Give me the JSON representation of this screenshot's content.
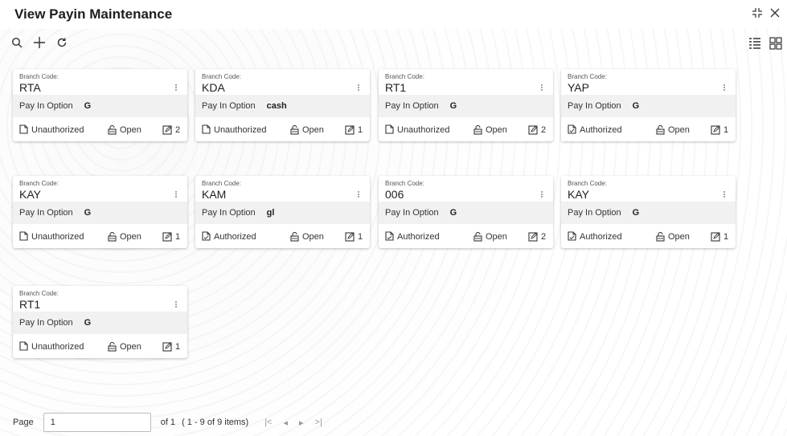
{
  "window": {
    "title": "View Payin Maintenance"
  },
  "toolbar": {
    "search": "search-icon",
    "add": "plus-icon",
    "refresh": "refresh-icon"
  },
  "cards": [
    {
      "code_label": "Branch Code:",
      "code": "RTA",
      "option_label": "Pay In Option",
      "option": "G",
      "auth": "Unauthorized",
      "status": "Open",
      "count": "2"
    },
    {
      "code_label": "Branch Code:",
      "code": "KDA",
      "option_label": "Pay In Option",
      "option": "cash",
      "auth": "Unauthorized",
      "status": "Open",
      "count": "1"
    },
    {
      "code_label": "Branch Code:",
      "code": "RT1",
      "option_label": "Pay In Option",
      "option": "G",
      "auth": "Unauthorized",
      "status": "Open",
      "count": "2"
    },
    {
      "code_label": "Branch Code:",
      "code": "YAP",
      "option_label": "Pay In Option",
      "option": "G",
      "auth": "Authorized",
      "status": "Open",
      "count": "1"
    },
    {
      "code_label": "Branch Code:",
      "code": "KAY",
      "option_label": "Pay In Option",
      "option": "G",
      "auth": "Unauthorized",
      "status": "Open",
      "count": "1"
    },
    {
      "code_label": "Branch Code:",
      "code": "KAM",
      "option_label": "Pay In Option",
      "option": "gl",
      "auth": "Authorized",
      "status": "Open",
      "count": "1"
    },
    {
      "code_label": "Branch Code:",
      "code": "006",
      "option_label": "Pay In Option",
      "option": "G",
      "auth": "Authorized",
      "status": "Open",
      "count": "2"
    },
    {
      "code_label": "Branch Code:",
      "code": "KAY",
      "option_label": "Pay In Option",
      "option": "G",
      "auth": "Authorized",
      "status": "Open",
      "count": "1"
    },
    {
      "code_label": "Branch Code:",
      "code": "RT1",
      "option_label": "Pay In Option",
      "option": "G",
      "auth": "Unauthorized",
      "status": "Open",
      "count": "1"
    }
  ],
  "pager": {
    "page_label": "Page",
    "page_value": "1",
    "of_text": "of 1",
    "range_text": "( 1 - 9 of 9 items)",
    "first": "|<",
    "prev": "◂",
    "next": "▸",
    "last": ">|"
  }
}
